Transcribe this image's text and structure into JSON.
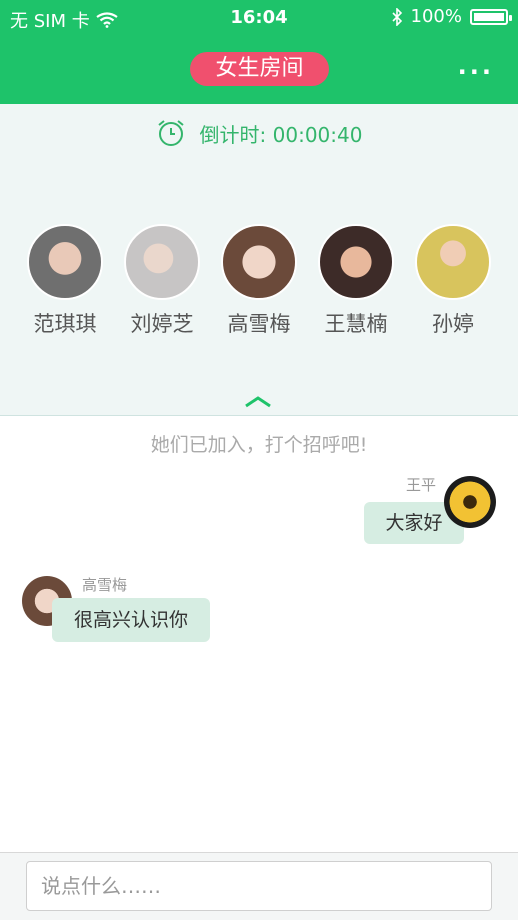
{
  "status_bar": {
    "carrier": "无 SIM 卡",
    "time": "16:04",
    "battery": "100%"
  },
  "header": {
    "title": "女生房间",
    "more": "···"
  },
  "countdown": {
    "label": "倒计时: 00:00:40"
  },
  "members": [
    {
      "name": "范琪琪",
      "color": "#6f6f6f"
    },
    {
      "name": "刘婷芝",
      "color": "#c7c5c5"
    },
    {
      "name": "高雪梅",
      "color": "#c98b6b"
    },
    {
      "name": "王慧楠",
      "color": "#3d2b28"
    },
    {
      "name": "孙婷",
      "color": "#d8c45d"
    }
  ],
  "chat": {
    "notice": "她们已加入，打个招呼吧!",
    "messages": [
      {
        "sender": "王平",
        "text": "大家好",
        "side": "right"
      },
      {
        "sender": "高雪梅",
        "text": "很高兴认识你",
        "side": "left"
      }
    ]
  },
  "input": {
    "placeholder": "说点什么……"
  },
  "colors": {
    "header_green": "#1ec36a",
    "title_pink": "#f0506e",
    "bubble_green": "#d6ede2"
  }
}
